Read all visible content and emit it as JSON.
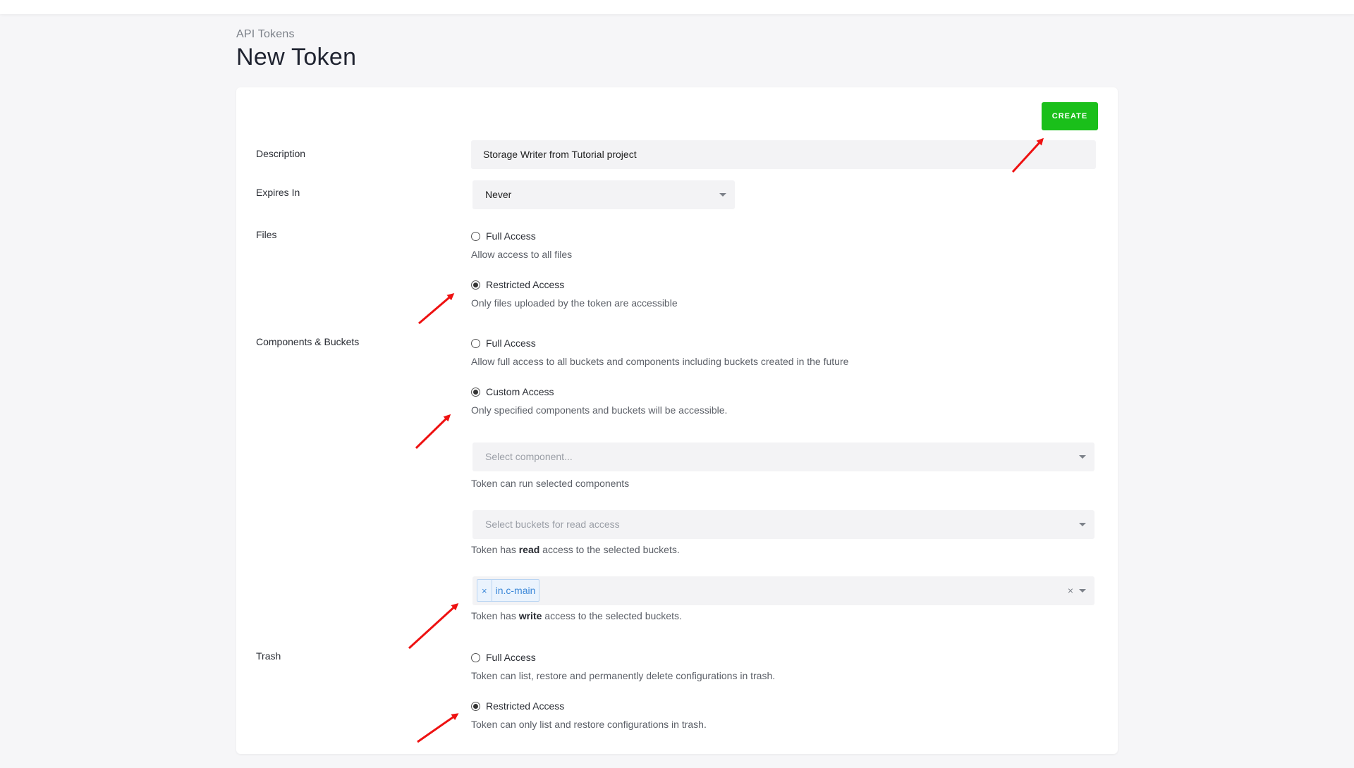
{
  "header": {
    "breadcrumb": "API Tokens",
    "title": "New Token"
  },
  "toolbar": {
    "create_label": "CREATE"
  },
  "form": {
    "description": {
      "label": "Description",
      "value": "Storage Writer from Tutorial project"
    },
    "expires": {
      "label": "Expires In",
      "value": "Never"
    },
    "files": {
      "label": "Files",
      "options": [
        {
          "label": "Full Access",
          "help": "Allow access to all files",
          "checked": false
        },
        {
          "label": "Restricted Access",
          "help": "Only files uploaded by the token are accessible",
          "checked": true
        }
      ]
    },
    "components": {
      "label": "Components & Buckets",
      "options": [
        {
          "label": "Full Access",
          "help": "Allow full access to all buckets and components including buckets created in the future",
          "checked": false
        },
        {
          "label": "Custom Access",
          "help": "Only specified components and buckets will be accessible.",
          "checked": true
        }
      ],
      "component_select": {
        "placeholder": "Select component...",
        "help": "Token can run selected components"
      },
      "read_select": {
        "placeholder": "Select buckets for read access",
        "help_pre": "Token has ",
        "help_bold": "read",
        "help_post": " access to the selected buckets."
      },
      "write_select": {
        "tag": "in.c-main",
        "tag_remove": "×",
        "clear": "×",
        "help_pre": "Token has ",
        "help_bold": "write",
        "help_post": " access to the selected buckets."
      }
    },
    "trash": {
      "label": "Trash",
      "options": [
        {
          "label": "Full Access",
          "help": "Token can list, restore and permanently delete configurations in trash.",
          "checked": false
        },
        {
          "label": "Restricted Access",
          "help": "Token can only list and restore configurations in trash.",
          "checked": true
        }
      ]
    }
  },
  "colors": {
    "accent": "#1abf1a",
    "annotation_arrow": "#ee1111",
    "tag": "#3a87d8"
  }
}
